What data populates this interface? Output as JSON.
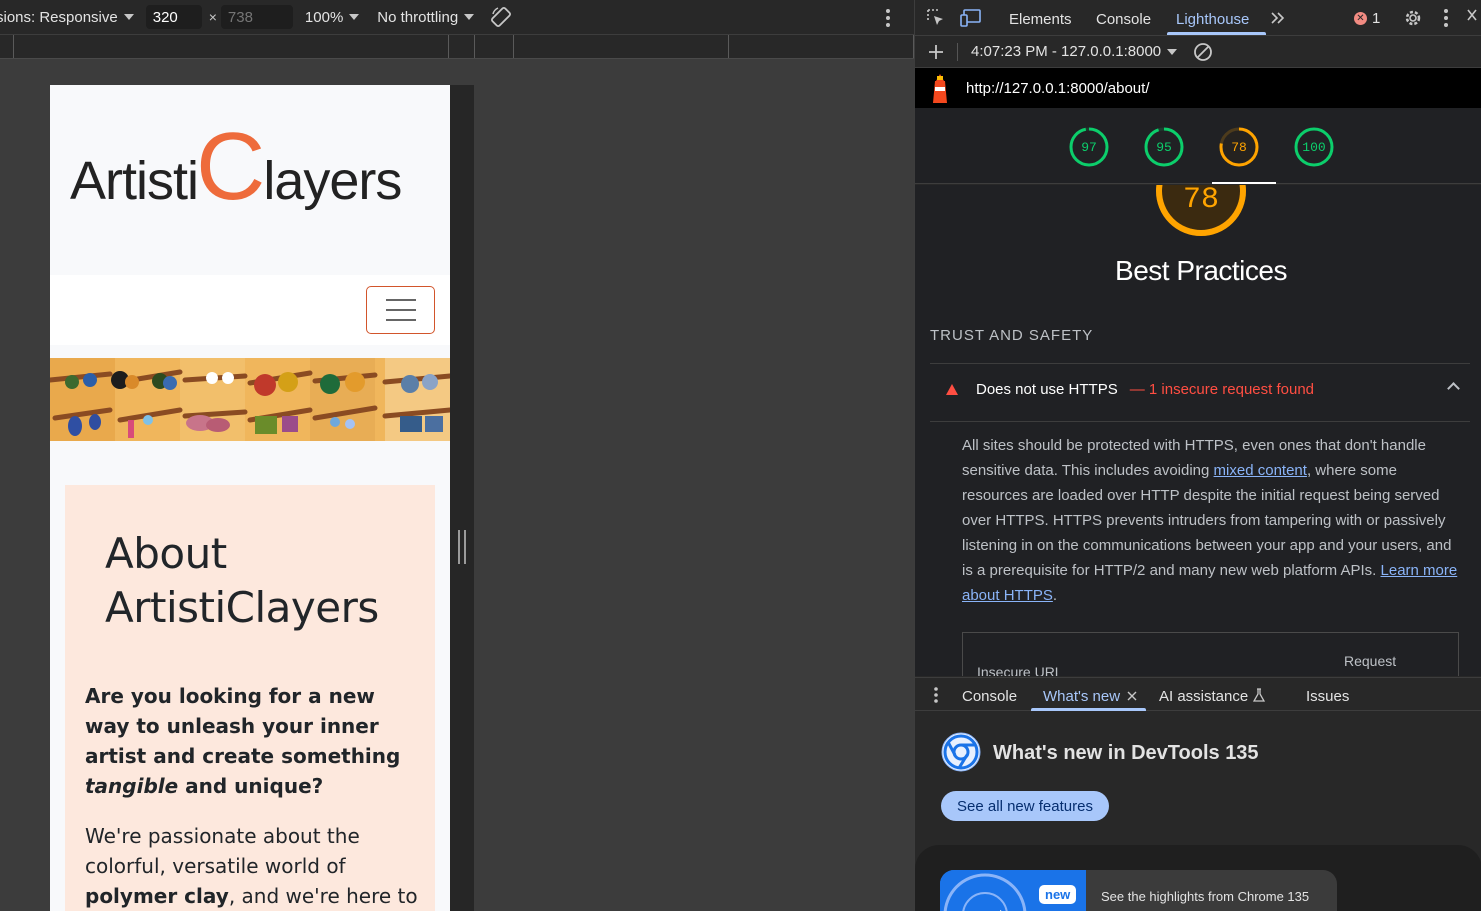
{
  "device_toolbar": {
    "dimensions_label": "sions: Responsive",
    "width_value": "320",
    "height_placeholder": "738",
    "times": "×",
    "zoom": "100%",
    "throttling": "No throttling"
  },
  "page": {
    "logo": {
      "part1": "Artisti",
      "part2": "C",
      "part3": "layers"
    },
    "heading": "About ArtistiClayers",
    "lead": {
      "t1": "Are you looking for a new way to unleash your inner artist and create something ",
      "em": "tangible",
      "t2": " and unique?"
    },
    "body": {
      "t1": "We're passionate about the colorful, versatile world of ",
      "b": "polymer clay",
      "t2": ", and we're here to share that passion with"
    }
  },
  "devtools": {
    "tabs": [
      "Elements",
      "Console",
      "Lighthouse"
    ],
    "error_count": "1",
    "report_time": "4:07:23 PM - 127.0.0.1:8000",
    "url": "http://127.0.0.1:8000/about/",
    "scores": [
      {
        "value": "97",
        "color": "#0cce6b"
      },
      {
        "value": "95",
        "color": "#0cce6b"
      },
      {
        "value": "78",
        "color": "#ffa400"
      },
      {
        "value": "100",
        "color": "#0cce6b"
      }
    ],
    "category_score": "78",
    "category_title": "Best Practices",
    "group_title": "TRUST AND SAFETY",
    "audit": {
      "title": "Does not use HTTPS",
      "display": "— 1 insecure request found",
      "desc_1": "All sites should be protected with HTTPS, even ones that don't handle sensitive data. This includes avoiding ",
      "link_1": "mixed content",
      "desc_2": ", where some resources are loaded over HTTP despite the initial request being served over HTTPS. HTTPS prevents intruders from tampering with or passively listening in on the communications between your app and your users, and is a prerequisite for HTTP/2 and many new web platform APIs. ",
      "link_2": "Learn more about HTTPS",
      "desc_3": ".",
      "col_url": "Insecure URL",
      "col_req": "Request"
    },
    "drawer_tabs": [
      "Console",
      "What's new",
      "AI assistance",
      "Issues"
    ],
    "whats_new": {
      "title": "What's new in DevTools 135",
      "button": "See all new features",
      "pill": "new",
      "highlight": "See the highlights from Chrome 135"
    }
  }
}
